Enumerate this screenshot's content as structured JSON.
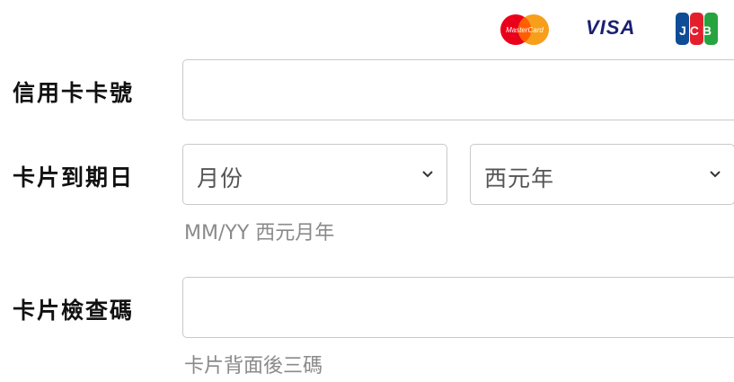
{
  "card_brands": {
    "mastercard": {
      "icon": "mastercard-logo",
      "text": "MasterCard"
    },
    "visa": {
      "icon": "visa-logo",
      "text": "VISA"
    },
    "jcb": {
      "icon": "jcb-logo",
      "text": "JCB"
    }
  },
  "form": {
    "card_number": {
      "label": "信用卡卡號",
      "value": ""
    },
    "expiry": {
      "label": "卡片到期日",
      "month_select": {
        "selected": "月份",
        "icon": "chevron-down-icon"
      },
      "year_select": {
        "selected": "西元年",
        "icon": "chevron-down-icon"
      },
      "hint": "MM/YY 西元月年"
    },
    "cvv": {
      "label": "卡片檢查碼",
      "value": "",
      "hint": "卡片背面後三碼"
    }
  },
  "colors": {
    "border": "#c9c9c9",
    "hint_text": "#8a8a8a",
    "visa_blue": "#1a1f71",
    "mastercard_red": "#eb001b",
    "mastercard_orange": "#f79e1b"
  }
}
